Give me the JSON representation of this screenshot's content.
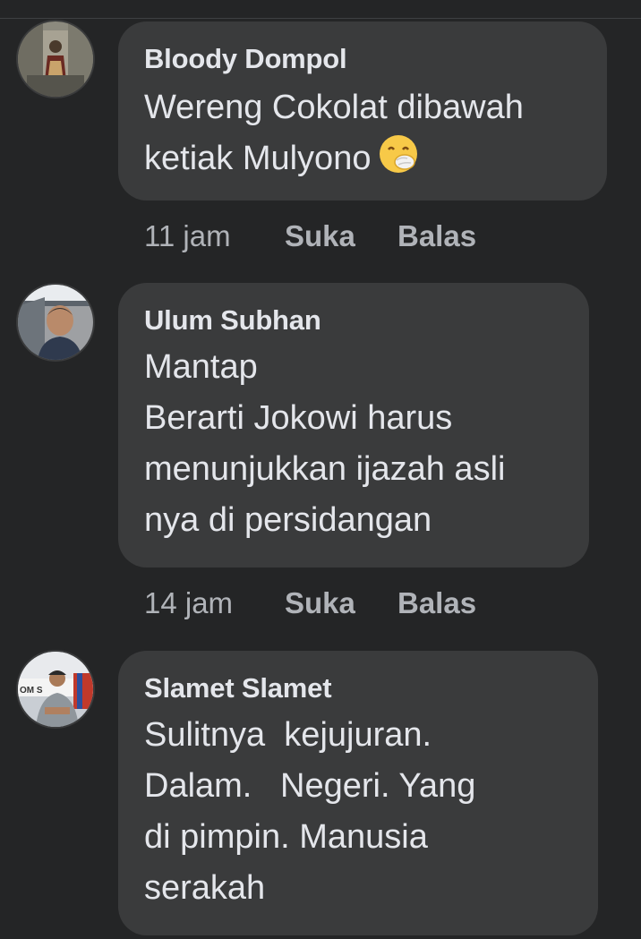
{
  "comments": [
    {
      "author": "Bloody Dompol",
      "text": "Wereng Cokolat dibawah\nketiak Mulyono",
      "emoji": "face-with-hand-over-mouth",
      "time": "11 jam",
      "like_label": "Suka",
      "reply_label": "Balas"
    },
    {
      "author": "Ulum Subhan",
      "text": "Mantap\nBerarti Jokowi harus\nmenunjukkan ijazah asli\nnya di persidangan",
      "time": "14 jam",
      "like_label": "Suka",
      "reply_label": "Balas"
    },
    {
      "author": "Slamet Slamet",
      "text": "Sulitnya  kejujuran.\nDalam.   Negeri. Yang\ndi pimpin. Manusia\nserakah"
    }
  ],
  "avatar_labels": {
    "slamet_banner": "OM S"
  },
  "colors": {
    "background": "#242526",
    "bubble": "#3a3b3c",
    "text_primary": "#e4e6eb",
    "text_secondary": "#b0b3b8"
  }
}
